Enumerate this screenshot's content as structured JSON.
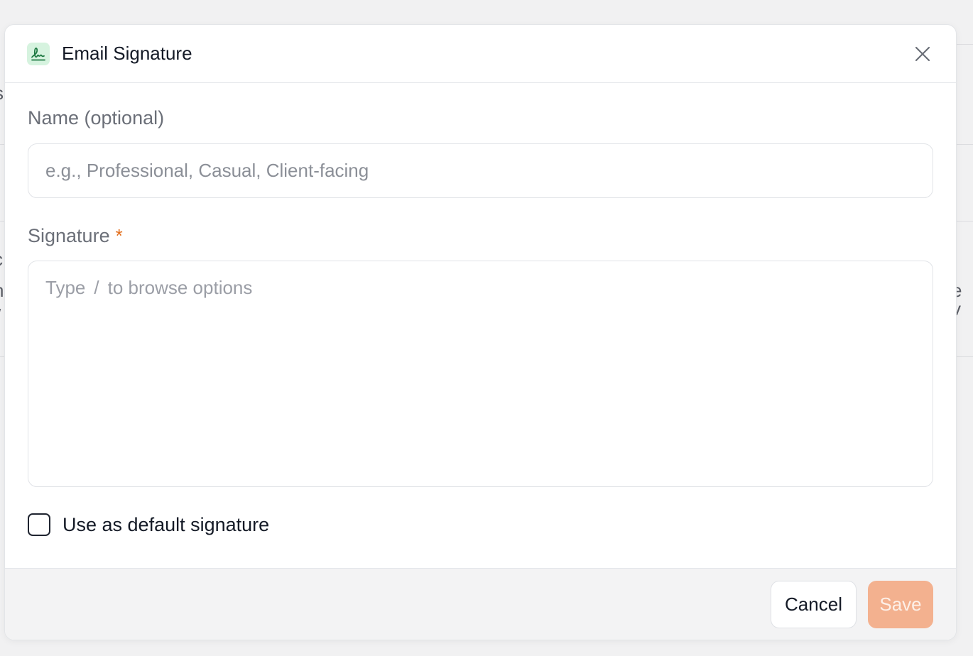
{
  "dialog": {
    "title": "Email Signature",
    "close_label": "Close"
  },
  "name_field": {
    "label": "Name (optional)",
    "placeholder": "e.g., Professional, Casual, Client-facing",
    "value": ""
  },
  "signature_field": {
    "label": "Signature",
    "required_marker": "*",
    "placeholder_prefix": "Type",
    "placeholder_slash": "/",
    "placeholder_suffix": "to browse options"
  },
  "default_option": {
    "label": "Use as default signature",
    "checked": false
  },
  "footer": {
    "cancel_label": "Cancel",
    "save_label": "Save"
  },
  "colors": {
    "accent": "#f3b18f",
    "required": "#e26e1c",
    "icon_bg": "#d6f3df",
    "icon_fg": "#1f7a43"
  },
  "background_fragments": {
    "left_1": "s",
    "left_2": "c",
    "left_3": "n",
    "left_4": "/",
    "right_1": "e v"
  }
}
